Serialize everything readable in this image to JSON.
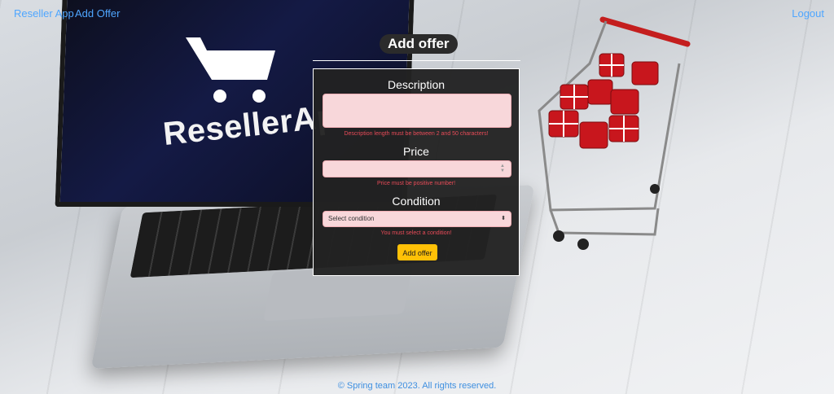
{
  "nav": {
    "brand": "Reseller App",
    "add_offer": "Add Offer",
    "logout": "Logout"
  },
  "page": {
    "title": "Add offer"
  },
  "form": {
    "description": {
      "label": "Description",
      "value": "",
      "error": "Description length must be between 2 and 50 characters!"
    },
    "price": {
      "label": "Price",
      "value": "",
      "error": "Price must be positive number!"
    },
    "condition": {
      "label": "Condition",
      "selected": "Select condition",
      "error": "You must select a condition!"
    },
    "submit_label": "Add offer"
  },
  "background": {
    "screen_text": "ResellerAp"
  },
  "footer": {
    "text": "© Spring team 2023. All rights reserved."
  },
  "colors": {
    "nav_link": "#4fa6ff",
    "invalid_field_bg": "#f8d7da",
    "error_text": "#e84b58",
    "button": "#ffc107",
    "card_bg": "#222222"
  }
}
